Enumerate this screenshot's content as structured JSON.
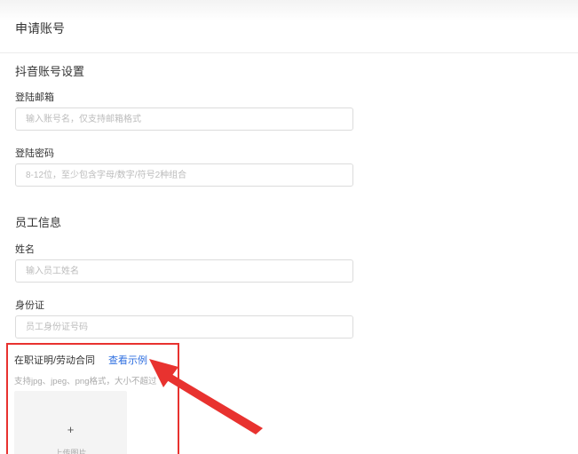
{
  "header": {
    "title": "申请账号"
  },
  "douyin_account": {
    "section_title": "抖音账号设置",
    "email": {
      "label": "登陆邮箱",
      "placeholder": "输入账号名，仅支持邮箱格式",
      "value": ""
    },
    "password": {
      "label": "登陆密码",
      "placeholder": "8-12位，至少包含字母/数字/符号2种组合",
      "value": ""
    }
  },
  "employee_info": {
    "section_title": "员工信息",
    "name": {
      "label": "姓名",
      "placeholder": "输入员工姓名",
      "value": ""
    },
    "id_card": {
      "label": "身份证",
      "placeholder": "员工身份证号码",
      "value": ""
    },
    "employment_proof": {
      "label": "在职证明/劳动合同",
      "example_link": "查看示例",
      "hint": "支持jpg、jpeg、png格式，大小不超过",
      "upload_plus": "+",
      "upload_text": "上传图片"
    }
  },
  "annotation": {
    "highlight_color": "#e8322f"
  }
}
